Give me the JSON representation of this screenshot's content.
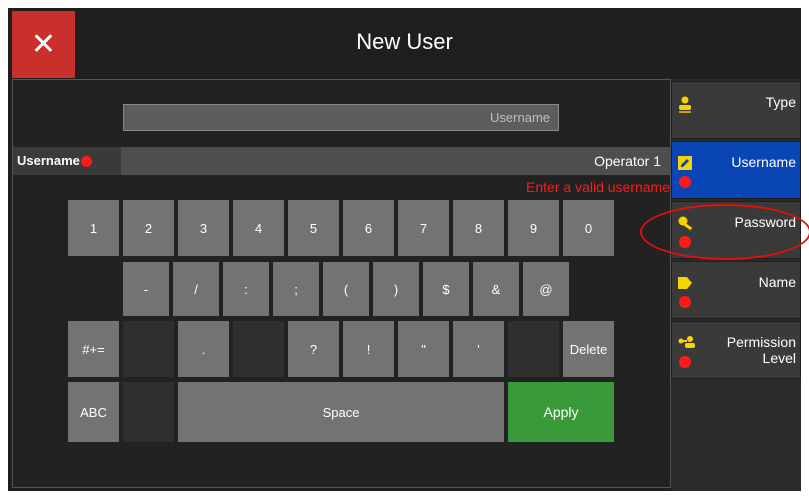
{
  "header": {
    "title": "New User",
    "close_icon": "✕"
  },
  "input": {
    "placeholder": "Username"
  },
  "field": {
    "label": "Username",
    "value": "Operator 1",
    "error": "Enter a valid username"
  },
  "keyboard": {
    "row1": [
      "1",
      "2",
      "3",
      "4",
      "5",
      "6",
      "7",
      "8",
      "9",
      "0"
    ],
    "row2": [
      "-",
      "/",
      ":",
      ";",
      "(",
      ")",
      "$",
      "&",
      "@"
    ],
    "row3": {
      "mode": "#+=",
      "period": ".",
      "question": "?",
      "exclaim": "!",
      "dquote": "\"",
      "squote": "'",
      "delete": "Delete"
    },
    "row4": {
      "abc": "ABC",
      "space": "Space",
      "apply": "Apply"
    }
  },
  "sidebar": {
    "items": [
      {
        "label": "Type",
        "icon": "person-icon"
      },
      {
        "label": "Username",
        "icon": "edit-icon"
      },
      {
        "label": "Password",
        "icon": "key-icon"
      },
      {
        "label": "Name",
        "icon": "tag-icon"
      },
      {
        "label": "Permission Level",
        "icon": "user-key-icon"
      }
    ]
  },
  "colors": {
    "accent": "#0a45b5",
    "apply": "#3a9a3a",
    "error": "#ff1a1a",
    "close": "#c9302c"
  }
}
